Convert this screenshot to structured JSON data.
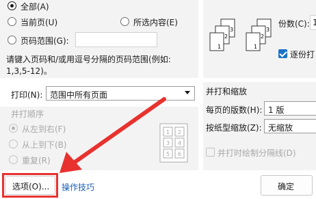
{
  "range": {
    "all_label": "全部(A)",
    "current_page_label": "当前页(U)",
    "selection_label": "所选内容(E)",
    "page_range_label": "页码范围(G):",
    "page_range_value": "",
    "hint": "请键入页码和/或用逗号分隔的页码范围(例如:",
    "hint_example": "1,3,5-12)。"
  },
  "print": {
    "label": "打印(N):",
    "value": "范围中所有页面"
  },
  "order": {
    "group_label": "并打顺序",
    "left_to_right": "从左到右(F)",
    "top_to_bottom": "从上到下(B)",
    "repeat": "重复(R)",
    "preview_numbers": [
      "1",
      "2",
      "3",
      "4",
      "5",
      "6"
    ]
  },
  "copies": {
    "label": "份数(C):",
    "value": "1",
    "collate_label": "逐份打",
    "page_icon_digits_a": [
      "3",
      "2",
      "1"
    ],
    "page_icon_digits_b": [
      "3",
      "2",
      "1"
    ]
  },
  "zoom": {
    "group_label": "并打和缩放",
    "pages_per_sheet_label": "每页的版数(H):",
    "pages_per_sheet_value": "1 版",
    "scale_to_paper_label": "按纸型缩放(Z):",
    "scale_to_paper_value": "无缩放",
    "draw_borders_label": "并打时绘制分隔线(D)"
  },
  "footer": {
    "options_button": "选项(O)...",
    "tips_link": "操作技巧",
    "ok_button": "确定"
  },
  "colors": {
    "annotation_red": "#e8322f",
    "accent_blue": "#1a73c8"
  }
}
